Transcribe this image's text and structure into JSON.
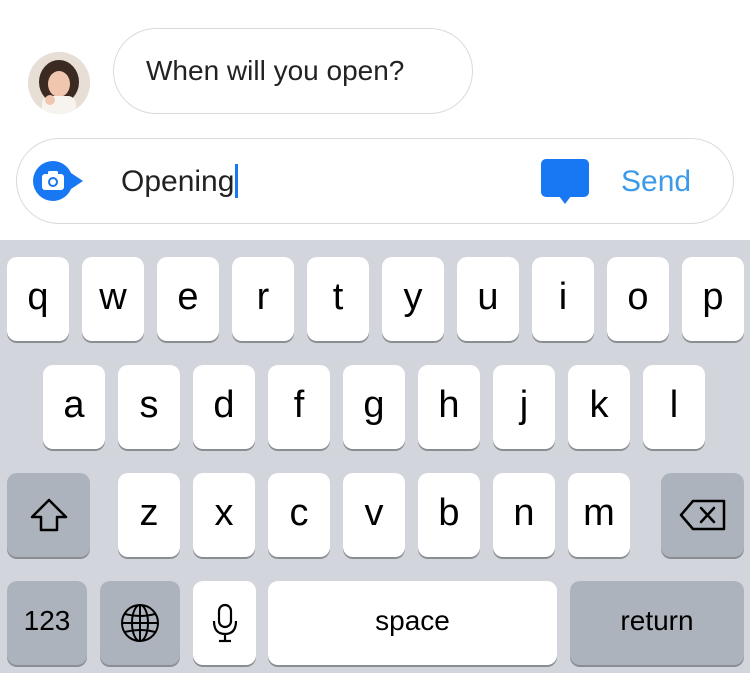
{
  "conversation": {
    "incoming_message": "When will you open?"
  },
  "composer": {
    "input_value": "Opening",
    "send_label": "Send",
    "camera_icon": "camera-icon",
    "chat_icon": "speech-bubble-icon"
  },
  "keyboard": {
    "row1": [
      "q",
      "w",
      "e",
      "r",
      "t",
      "y",
      "u",
      "i",
      "o",
      "p"
    ],
    "row2": [
      "a",
      "s",
      "d",
      "f",
      "g",
      "h",
      "j",
      "k",
      "l"
    ],
    "row3": [
      "z",
      "x",
      "c",
      "v",
      "b",
      "n",
      "m"
    ],
    "numbers_label": "123",
    "space_label": "space",
    "return_label": "return",
    "shift_icon": "shift-icon",
    "delete_icon": "backspace-icon",
    "globe_icon": "globe-icon",
    "mic_icon": "microphone-icon"
  },
  "colors": {
    "accent": "#1877f2",
    "send_text": "#3d9ae8",
    "keyboard_bg": "#d2d5db",
    "key_dark": "#adb3bc"
  }
}
